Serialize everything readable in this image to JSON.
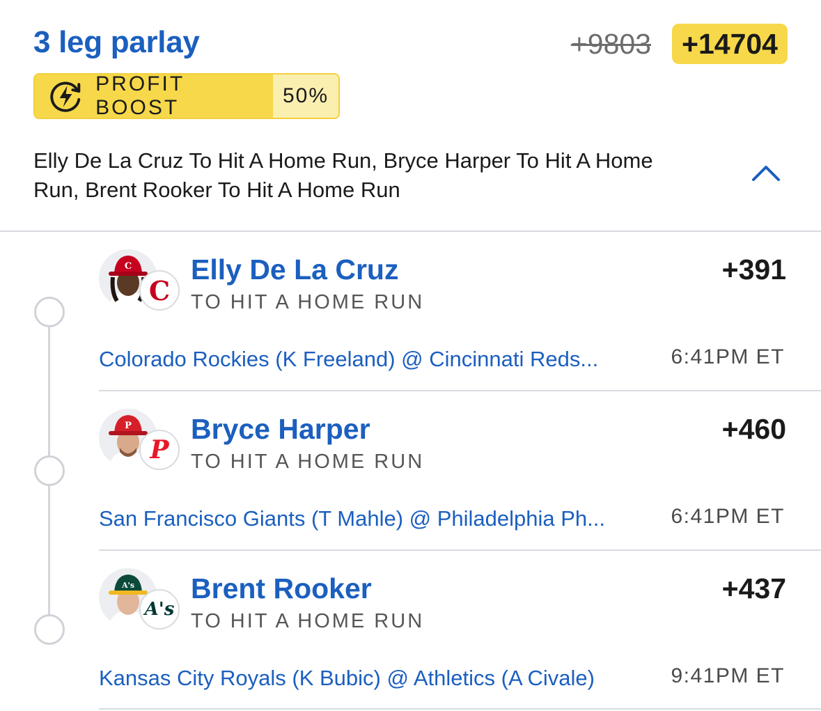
{
  "header": {
    "title": "3 leg parlay",
    "old_odds": "+9803",
    "new_odds": "+14704"
  },
  "boost": {
    "label": "PROFIT BOOST",
    "percent": "50%"
  },
  "summary": "Elly De La Cruz To Hit A Home Run, Bryce Harper To Hit A Home Run, Brent Rooker To Hit A Home Run",
  "legs": [
    {
      "player": "Elly De La Cruz",
      "market": "TO HIT A HOME RUN",
      "odds": "+391",
      "matchup": "Colorado Rockies (K Freeland) @ Cincinnati Reds...",
      "time": "6:41PM ET",
      "team_logo_text": "C",
      "team_color": "#c6011f",
      "cap_color": "#c6011f"
    },
    {
      "player": "Bryce Harper",
      "market": "TO HIT A HOME RUN",
      "odds": "+460",
      "matchup": "San Francisco Giants (T Mahle) @ Philadelphia Ph...",
      "time": "6:41PM ET",
      "team_logo_text": "P",
      "team_color": "#e81828",
      "cap_color": "#d61f2a"
    },
    {
      "player": "Brent Rooker",
      "market": "TO HIT A HOME RUN",
      "odds": "+437",
      "matchup": "Kansas City Royals (K Bubic) @ Athletics (A Civale)",
      "time": "9:41PM ET",
      "team_logo_text": "A's",
      "team_color": "#003831",
      "cap_color": "#0b4a3a"
    }
  ],
  "colors": {
    "accent": "#1b5fbf",
    "boost_yellow": "#f6d84a",
    "boost_light": "#fbefb0"
  }
}
